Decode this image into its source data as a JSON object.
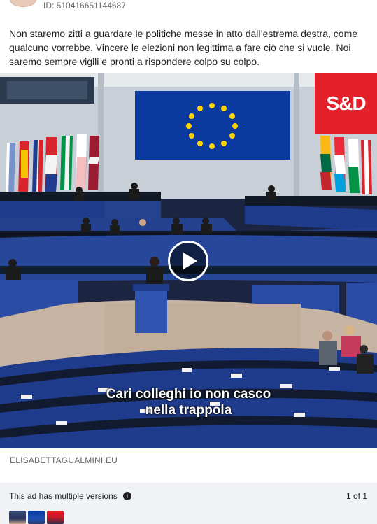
{
  "header": {
    "library_id": "ID: 510416651144687"
  },
  "ad": {
    "body_text": "Non staremo zitti a guardare le politiche messe in atto dall’estrema destra, come qualcuno vorrebbe. Vincere le elezioni non legittima a fare ciò che si vuole. Noi saremo sempre vigili e pronti a rispondere colpo su colpo."
  },
  "video": {
    "logo_text": "S&D",
    "subtitle_line1": "Cari colleghi io non casco",
    "subtitle_line2": "nella trappola",
    "play_icon": "play-icon"
  },
  "link": {
    "domain": "ELISABETTAGUALMINI.EU"
  },
  "footer": {
    "versions_text": "This ad has multiple versions",
    "info_icon": "info-icon",
    "info_glyph": "i",
    "count_text": "1 of 1"
  },
  "colors": {
    "brand_red": "#e4202b",
    "eu_blue": "#0a3aa0",
    "muted": "#65676b",
    "footer_bg": "#f0f2f5"
  }
}
